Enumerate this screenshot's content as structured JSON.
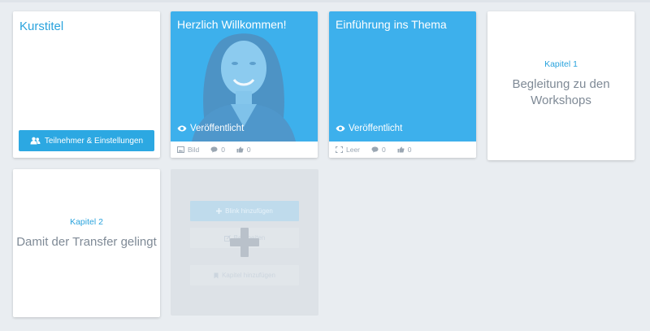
{
  "course": {
    "title": "Kurstitel",
    "participants_button": "Teilnehmer & Einstellungen",
    "participants_icon": "users-icon"
  },
  "cards": [
    {
      "title": "Herzlich Willkommen!",
      "status": "Veröffentlicht",
      "media_type": "Bild",
      "comments": "0",
      "likes": "0"
    },
    {
      "title": "Einführung ins Thema",
      "status": "Veröffentlicht",
      "media_type": "Leer",
      "comments": "0",
      "likes": "0"
    }
  ],
  "chapters": [
    {
      "number_label": "Kapitel 1",
      "name": "Begleitung zu den Workshops"
    },
    {
      "number_label": "Kapitel 2",
      "name": "Damit der Transfer gelingt"
    }
  ],
  "add_menu": {
    "add_block": "Blink hinzufügen",
    "edit": "Bearbeiten",
    "add_chapter": "Kapitel hinzufügen"
  },
  "colors": {
    "accent": "#2aa3dd",
    "card_blue": "#3db0ec",
    "background": "#e9edf1",
    "muted_text": "#7f8a96"
  }
}
